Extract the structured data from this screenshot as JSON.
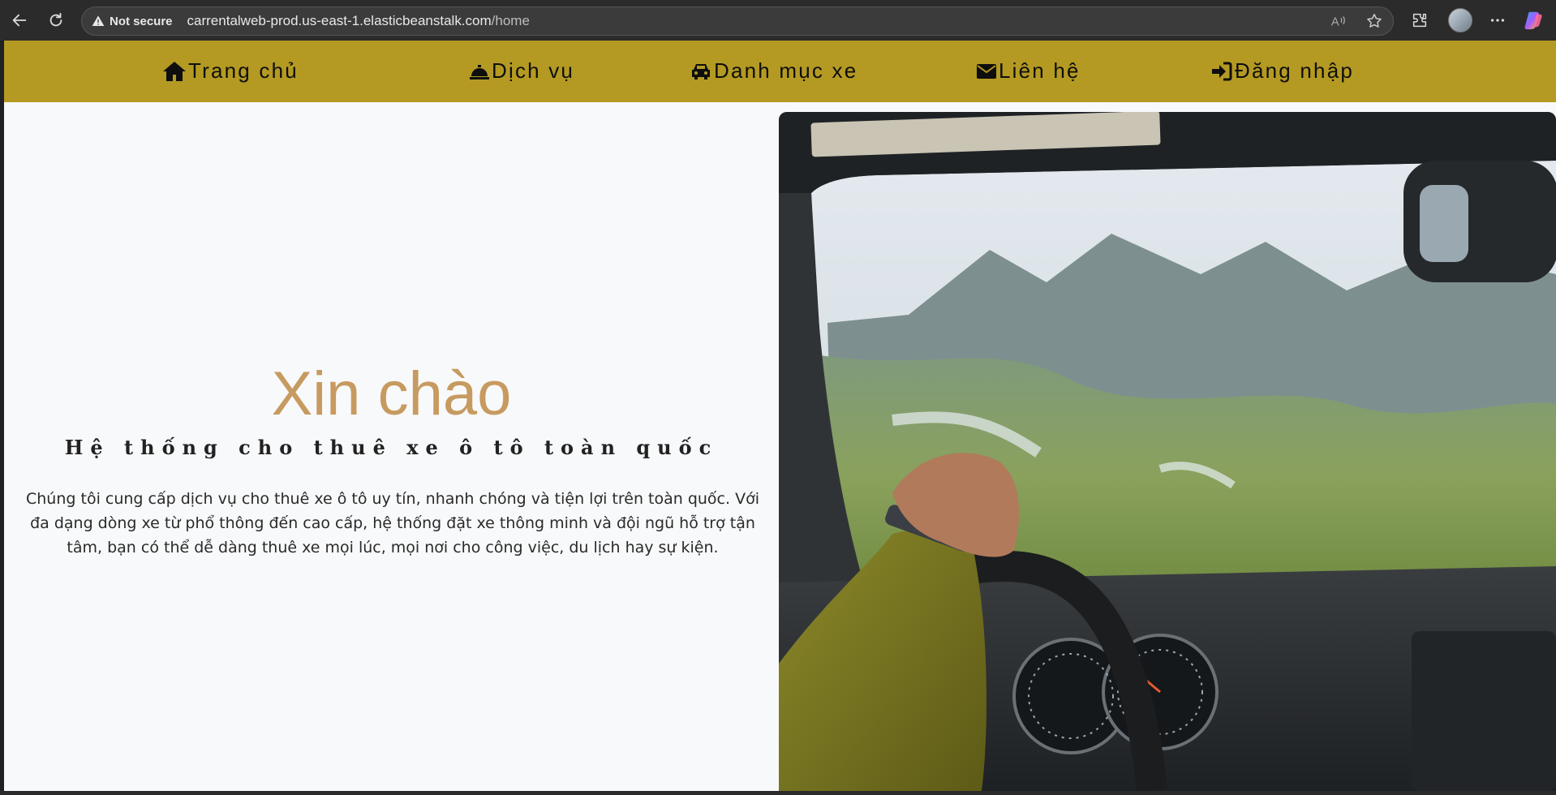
{
  "browser": {
    "security_label": "Not secure",
    "url_host": "carrentalweb-prod.us-east-1.elasticbeanstalk.com",
    "url_path": "/home",
    "icons": [
      "back-icon",
      "reload-icon",
      "warning-icon",
      "read-aloud-icon",
      "favorite-star-icon",
      "extensions-icon",
      "profile-avatar",
      "more-menu-icon",
      "copilot-icon"
    ]
  },
  "navbar": {
    "background": "#b49a22",
    "items": [
      {
        "label": "Trang chủ",
        "icon": "home-icon"
      },
      {
        "label": "Dịch vụ",
        "icon": "service-bell-icon"
      },
      {
        "label": "Danh mục xe",
        "icon": "car-icon"
      },
      {
        "label": "Liên hệ",
        "icon": "envelope-icon"
      },
      {
        "label": "Đăng nhập",
        "icon": "sign-in-icon"
      }
    ]
  },
  "hero": {
    "title": "Xin chào",
    "title_color": "#c79a60",
    "subtitle": "Hệ thống cho thuê xe ô tô toàn quốc",
    "description": "Chúng tôi cung cấp dịch vụ cho thuê xe ô tô uy tín, nhanh chóng và tiện lợi trên toàn quốc. Với đa dạng dòng xe từ phổ thông đến cao cấp, hệ thống đặt xe thông minh và đội ngũ hỗ trợ tận tâm, bạn có thể dễ dàng thuê xe mọi lúc, mọi nơi cho công việc, du lịch hay sự kiện."
  }
}
